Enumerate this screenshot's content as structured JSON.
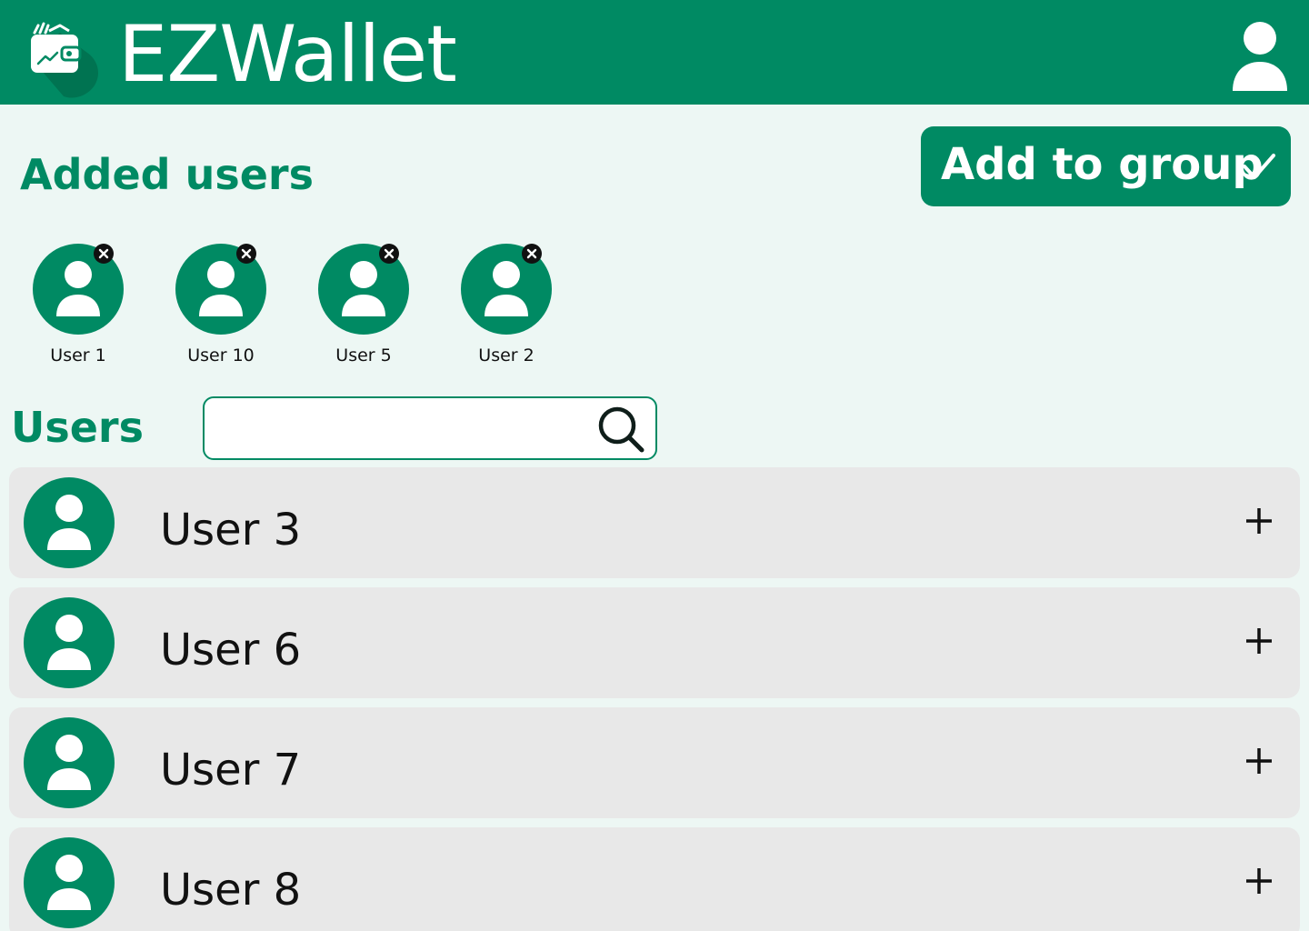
{
  "header": {
    "app_title": "EZWallet",
    "logo_icon": "wallet-logo-icon",
    "profile_icon": "user-profile-icon",
    "background_color": "#008A63"
  },
  "added_section": {
    "title": "Added users",
    "users": [
      {
        "label": "User 1"
      },
      {
        "label": "User 10"
      },
      {
        "label": "User 5"
      },
      {
        "label": "User 2"
      }
    ]
  },
  "add_group_button": {
    "label": "Add to group",
    "icon": "check-icon"
  },
  "users_section": {
    "title": "Users",
    "search": {
      "value": "",
      "placeholder": "",
      "icon": "search-icon"
    },
    "list": [
      {
        "label": "User 3",
        "action_icon": "plus-icon"
      },
      {
        "label": "User 6",
        "action_icon": "plus-icon"
      },
      {
        "label": "User 7",
        "action_icon": "plus-icon"
      },
      {
        "label": "User 8",
        "action_icon": "plus-icon"
      }
    ]
  },
  "colors": {
    "accent": "#008A63",
    "background": "#EDF7F4",
    "row_background": "#E8E8E8"
  }
}
